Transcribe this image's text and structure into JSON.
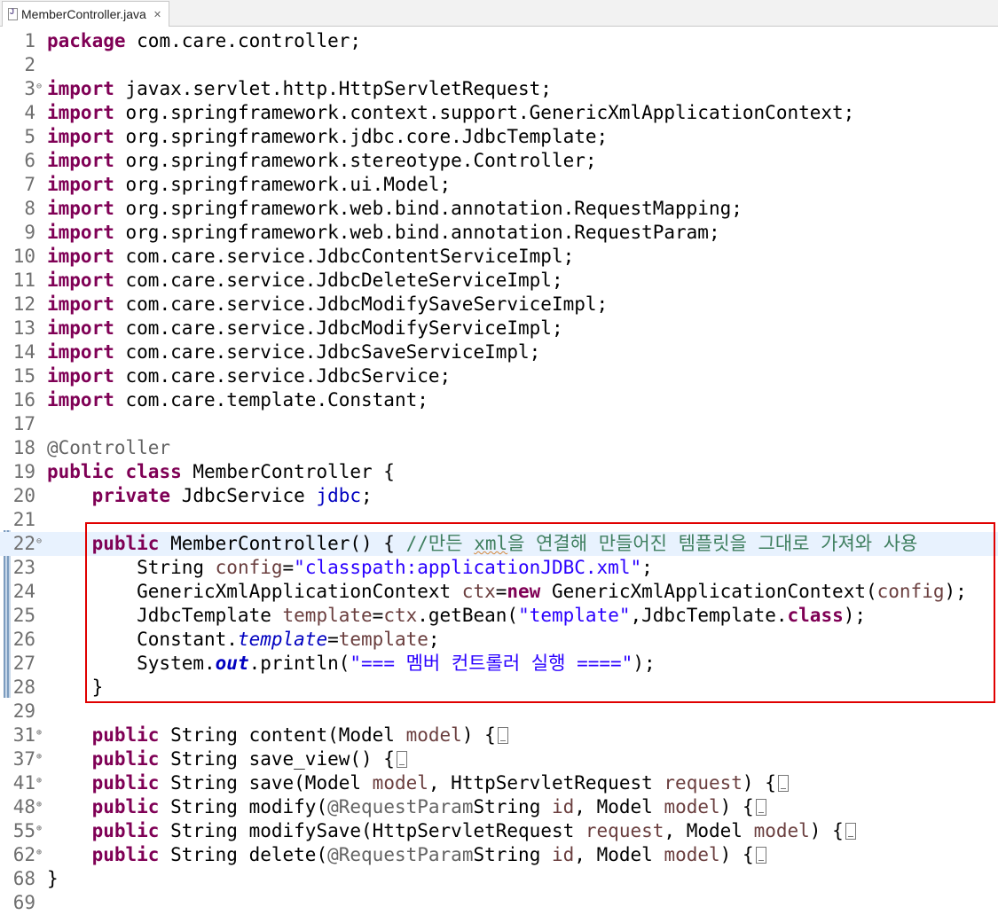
{
  "tab": {
    "title": "MemberController.java",
    "close_label": "✕"
  },
  "lines": [
    {
      "n": "1",
      "fold": "",
      "segs": [
        [
          "kw",
          "package"
        ],
        [
          "",
          "com.care.controller;"
        ]
      ]
    },
    {
      "n": "2",
      "fold": "",
      "segs": []
    },
    {
      "n": "3",
      "fold": "⊖",
      "segs": [
        [
          "kw",
          "import"
        ],
        [
          "",
          "javax.servlet.http.HttpServletRequest;"
        ]
      ]
    },
    {
      "n": "4",
      "fold": "",
      "segs": [
        [
          "kw",
          "import"
        ],
        [
          "",
          "org.springframework.context.support.GenericXmlApplicationContext;"
        ]
      ]
    },
    {
      "n": "5",
      "fold": "",
      "segs": [
        [
          "kw",
          "import"
        ],
        [
          "",
          "org.springframework.jdbc.core.JdbcTemplate;"
        ]
      ]
    },
    {
      "n": "6",
      "fold": "",
      "segs": [
        [
          "kw",
          "import"
        ],
        [
          "",
          "org.springframework.stereotype.Controller;"
        ]
      ]
    },
    {
      "n": "7",
      "fold": "",
      "segs": [
        [
          "kw",
          "import"
        ],
        [
          "",
          "org.springframework.ui.Model;"
        ]
      ]
    },
    {
      "n": "8",
      "fold": "",
      "segs": [
        [
          "kw",
          "import"
        ],
        [
          "",
          "org.springframework.web.bind.annotation.RequestMapping;"
        ]
      ]
    },
    {
      "n": "9",
      "fold": "",
      "segs": [
        [
          "kw",
          "import"
        ],
        [
          "",
          "org.springframework.web.bind.annotation.RequestParam;"
        ]
      ]
    },
    {
      "n": "10",
      "fold": "",
      "segs": [
        [
          "kw",
          "import"
        ],
        [
          "",
          "com.care.service.JdbcContentServiceImpl;"
        ]
      ]
    },
    {
      "n": "11",
      "fold": "",
      "segs": [
        [
          "kw",
          "import"
        ],
        [
          "",
          "com.care.service.JdbcDeleteServiceImpl;"
        ]
      ]
    },
    {
      "n": "12",
      "fold": "",
      "segs": [
        [
          "kw",
          "import"
        ],
        [
          "",
          "com.care.service.JdbcModifySaveServiceImpl;"
        ]
      ]
    },
    {
      "n": "13",
      "fold": "",
      "segs": [
        [
          "kw",
          "import"
        ],
        [
          "",
          "com.care.service.JdbcModifyServiceImpl;"
        ]
      ]
    },
    {
      "n": "14",
      "fold": "",
      "segs": [
        [
          "kw",
          "import"
        ],
        [
          "",
          "com.care.service.JdbcSaveServiceImpl;"
        ]
      ]
    },
    {
      "n": "15",
      "fold": "",
      "segs": [
        [
          "kw",
          "import"
        ],
        [
          "",
          "com.care.service.JdbcService;"
        ]
      ]
    },
    {
      "n": "16",
      "fold": "",
      "segs": [
        [
          "kw",
          "import"
        ],
        [
          "",
          "com.care.template.Constant;"
        ]
      ]
    },
    {
      "n": "17",
      "fold": "",
      "segs": []
    },
    {
      "n": "18",
      "fold": "",
      "segs": [
        [
          "ann",
          "@Controller"
        ]
      ]
    },
    {
      "n": "19",
      "fold": "",
      "segs": [
        [
          "kw",
          "public"
        ],
        [
          "kw",
          "class"
        ],
        [
          "",
          "MemberController {"
        ]
      ]
    },
    {
      "n": "20",
      "fold": "",
      "segs": [
        [
          "",
          "    "
        ],
        [
          "kw",
          "private"
        ],
        [
          "",
          "JdbcService "
        ],
        [
          "field",
          "jdbc"
        ],
        [
          "",
          ";"
        ]
      ]
    },
    {
      "n": "21",
      "fold": "",
      "segs": []
    },
    {
      "n": "22",
      "fold": "⊖",
      "current": true,
      "segs": [
        [
          "",
          "    "
        ],
        [
          "kw",
          "public"
        ],
        [
          "",
          "MemberController() { "
        ],
        [
          "cmt",
          "//만든 "
        ],
        [
          "cmt squig",
          "xml"
        ],
        [
          "cmt",
          "을 연결해 만들어진 템플릿을 그대로 가져와 사용"
        ]
      ]
    },
    {
      "n": "23",
      "fold": "",
      "segs": [
        [
          "",
          "        String "
        ],
        [
          "var",
          "config"
        ],
        [
          "",
          "="
        ],
        [
          "str",
          "\"classpath:applicationJDBC.xml\""
        ],
        [
          "",
          ";"
        ]
      ]
    },
    {
      "n": "24",
      "fold": "",
      "segs": [
        [
          "",
          "        GenericXmlApplicationContext "
        ],
        [
          "var",
          "ctx"
        ],
        [
          "",
          "="
        ],
        [
          "kw",
          "new"
        ],
        [
          "",
          "GenericXmlApplicationContext("
        ],
        [
          "var",
          "config"
        ],
        [
          "",
          ");"
        ]
      ]
    },
    {
      "n": "25",
      "fold": "",
      "segs": [
        [
          "",
          "        JdbcTemplate "
        ],
        [
          "var",
          "template"
        ],
        [
          "",
          "="
        ],
        [
          "var",
          "ctx"
        ],
        [
          "",
          ".getBean("
        ],
        [
          "str",
          "\"template\""
        ],
        [
          "",
          ",JdbcTemplate."
        ],
        [
          "kw",
          "class"
        ],
        [
          "",
          ");"
        ]
      ]
    },
    {
      "n": "26",
      "fold": "",
      "segs": [
        [
          "",
          "        Constant."
        ],
        [
          "sfield",
          "template"
        ],
        [
          "",
          "="
        ],
        [
          "var",
          "template"
        ],
        [
          "",
          ";"
        ]
      ]
    },
    {
      "n": "27",
      "fold": "",
      "segs": [
        [
          "",
          "        System."
        ],
        [
          "sfield-b",
          "out"
        ],
        [
          "",
          ".println("
        ],
        [
          "str",
          "\"=== 멤버 컨트롤러 실행 ====\""
        ],
        [
          "",
          ");"
        ]
      ]
    },
    {
      "n": "28",
      "fold": "",
      "segs": [
        [
          "",
          "    }"
        ]
      ]
    },
    {
      "n": "29",
      "fold": "",
      "segs": []
    },
    {
      "n": "31",
      "fold": "⊕",
      "collapsed": true,
      "segs": [
        [
          "",
          "    "
        ],
        [
          "kw",
          "public"
        ],
        [
          "",
          "String content(Model "
        ],
        [
          "var",
          "model"
        ],
        [
          "",
          ") {"
        ]
      ]
    },
    {
      "n": "37",
      "fold": "⊕",
      "collapsed": true,
      "segs": [
        [
          "",
          "    "
        ],
        [
          "kw",
          "public"
        ],
        [
          "",
          "String save_view() {"
        ]
      ]
    },
    {
      "n": "41",
      "fold": "⊕",
      "collapsed": true,
      "segs": [
        [
          "",
          "    "
        ],
        [
          "kw",
          "public"
        ],
        [
          "",
          "String save(Model "
        ],
        [
          "var",
          "model"
        ],
        [
          "",
          ", HttpServletRequest "
        ],
        [
          "var",
          "request"
        ],
        [
          "",
          ") {"
        ]
      ]
    },
    {
      "n": "48",
      "fold": "⊕",
      "collapsed": true,
      "segs": [
        [
          "",
          "    "
        ],
        [
          "kw",
          "public"
        ],
        [
          "",
          "String modify("
        ],
        [
          "ann",
          "@RequestParam"
        ],
        [
          "",
          "String "
        ],
        [
          "var",
          "id"
        ],
        [
          "",
          ", Model "
        ],
        [
          "var",
          "model"
        ],
        [
          "",
          ") {"
        ]
      ]
    },
    {
      "n": "55",
      "fold": "⊕",
      "collapsed": true,
      "segs": [
        [
          "",
          "    "
        ],
        [
          "kw",
          "public"
        ],
        [
          "",
          "String modifySave(HttpServletRequest "
        ],
        [
          "var",
          "request"
        ],
        [
          "",
          ", Model "
        ],
        [
          "var",
          "model"
        ],
        [
          "",
          ") {"
        ]
      ]
    },
    {
      "n": "62",
      "fold": "⊕",
      "collapsed": true,
      "segs": [
        [
          "",
          "    "
        ],
        [
          "kw",
          "public"
        ],
        [
          "",
          "String delete("
        ],
        [
          "ann",
          "@RequestParam"
        ],
        [
          "",
          "String "
        ],
        [
          "var",
          "id"
        ],
        [
          "",
          ", Model "
        ],
        [
          "var",
          "model"
        ],
        [
          "",
          ") {"
        ]
      ]
    },
    {
      "n": "68",
      "fold": "",
      "segs": [
        [
          "",
          "}"
        ]
      ]
    },
    {
      "n": "69",
      "fold": "",
      "segs": []
    }
  ]
}
